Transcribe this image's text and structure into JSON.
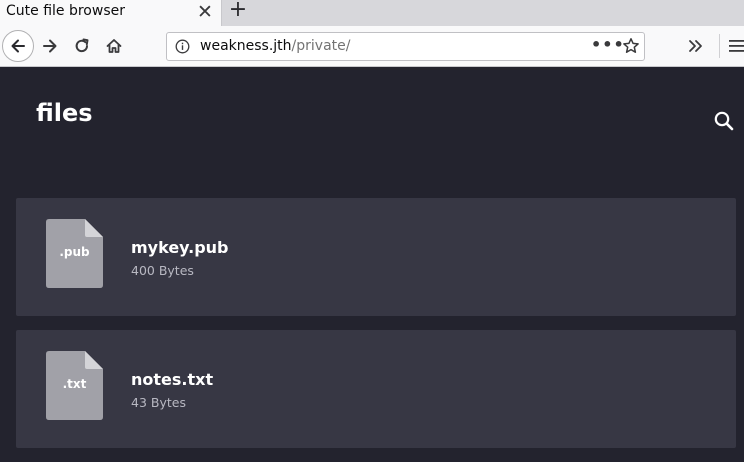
{
  "browser": {
    "tab_title": "Cute file browser",
    "tab_close_glyph": "✕",
    "new_tab_glyph": "+",
    "url_host": "weakness.jth",
    "url_path": "/private/",
    "page_actions_glyph": "•••"
  },
  "page": {
    "title": "files"
  },
  "files": [
    {
      "ext": ".pub",
      "name": "mykey.pub",
      "size": "400 Bytes"
    },
    {
      "ext": ".txt",
      "name": "notes.txt",
      "size": "43 Bytes"
    }
  ],
  "colors": {
    "page_background": "#23232e",
    "card_background": "#373744",
    "file_icon": "#a1a1a8",
    "file_icon_fold": "#d4d4d8"
  },
  "icons": {
    "back": "arrow-left-icon",
    "forward": "arrow-right-icon",
    "reload": "reload-icon",
    "home": "home-icon",
    "info": "info-icon",
    "bookmark": "star-icon",
    "overflow": "chevron-double-right-icon",
    "menu": "hamburger-menu-icon",
    "search": "search-icon",
    "file": "file-icon"
  }
}
